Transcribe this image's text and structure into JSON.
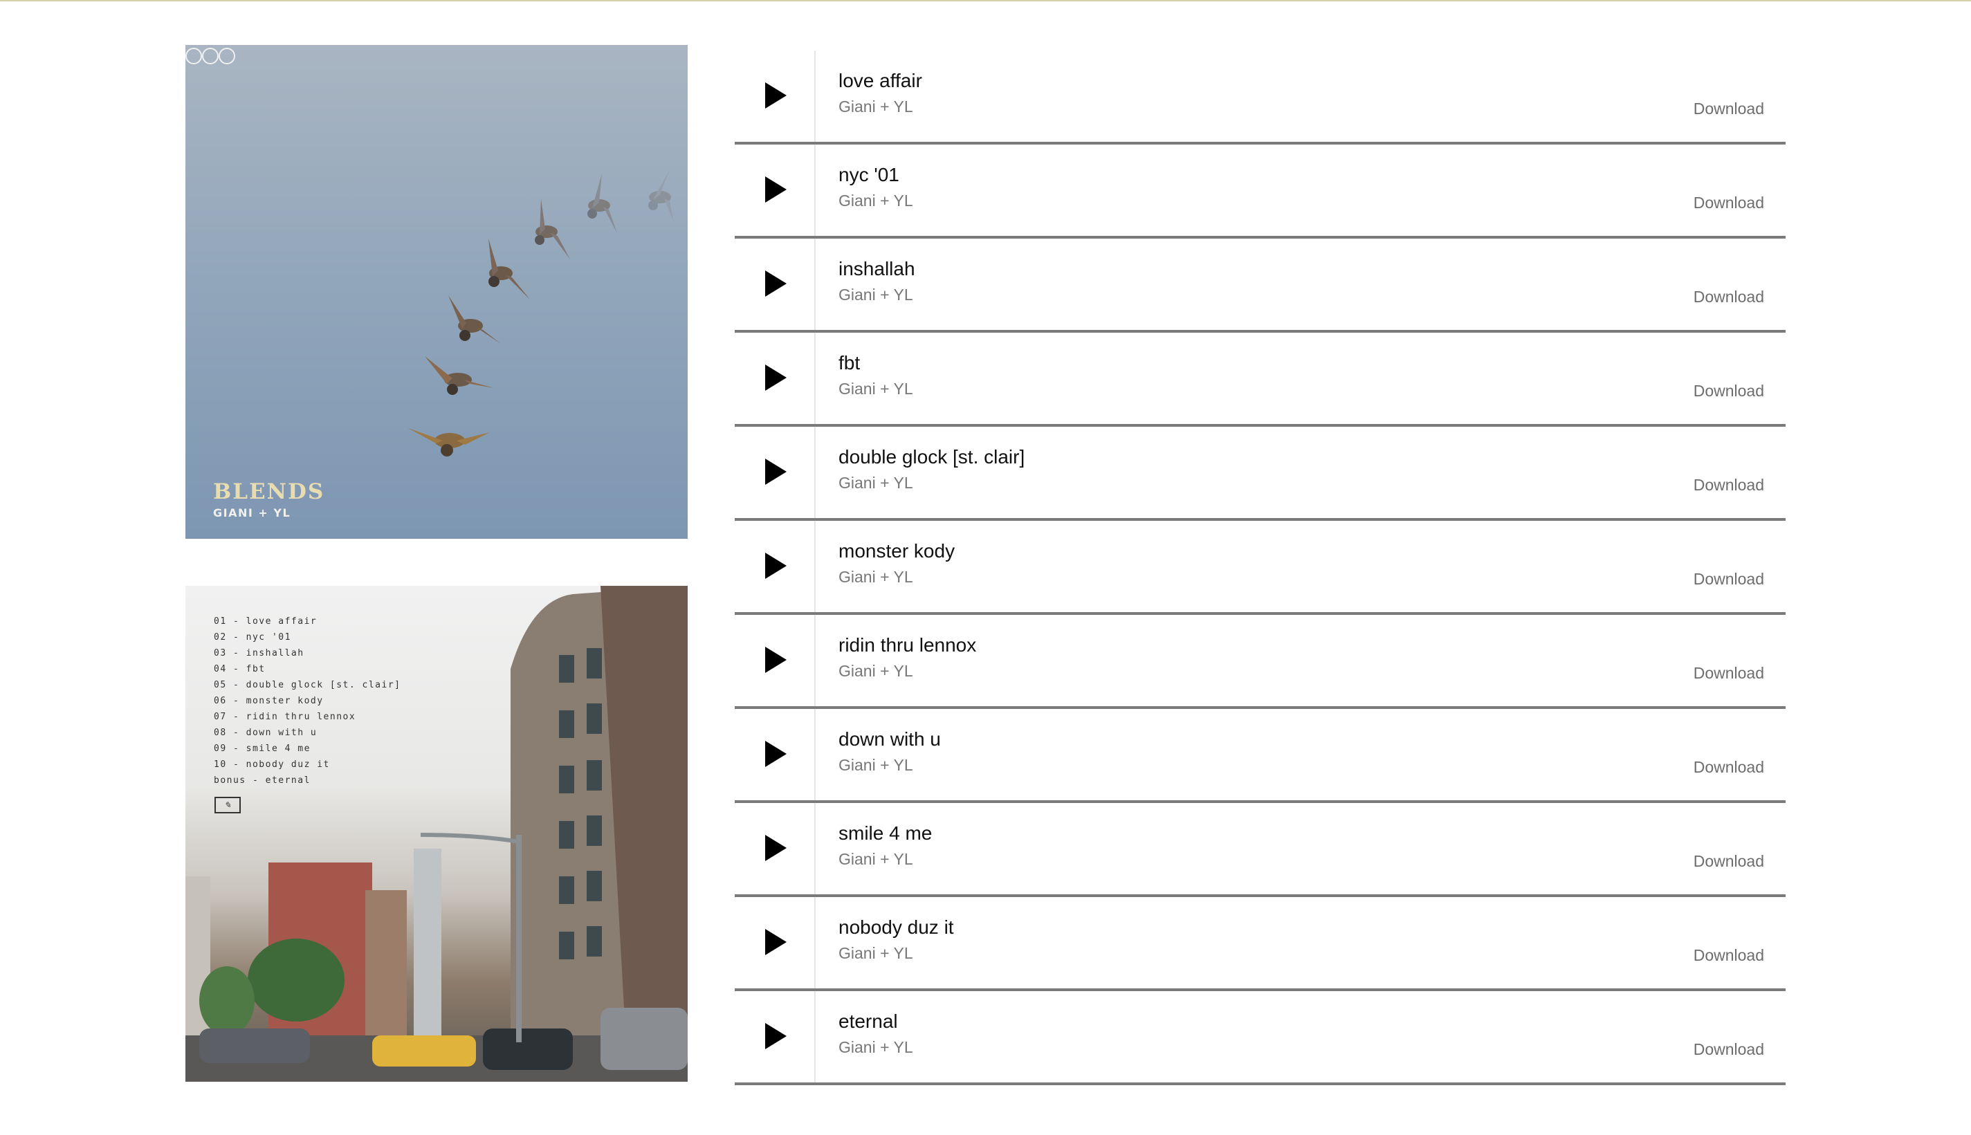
{
  "album": {
    "front_cover": {
      "logo_text": "BLENDS",
      "artist_text": "GIANI + YL",
      "badge_icons": [
        "circle-badge",
        "circle-badge",
        "circle-badge"
      ]
    },
    "back_cover": {
      "tracklist": [
        "01 - love affair",
        "02 - nyc '01",
        "03 - inshallah",
        "04 - fbt",
        "05 - double glock [st. clair]",
        "06 - monster kody",
        "07 - ridin thru lennox",
        "08 - down with u",
        "09 - smile 4 me",
        "10 - nobody duz it",
        "bonus - eternal"
      ]
    }
  },
  "tracks": [
    {
      "title": "love affair",
      "artist": "Giani + YL",
      "download_label": "Download"
    },
    {
      "title": "nyc '01",
      "artist": "Giani + YL",
      "download_label": "Download"
    },
    {
      "title": "inshallah",
      "artist": "Giani + YL",
      "download_label": "Download"
    },
    {
      "title": "fbt",
      "artist": "Giani + YL",
      "download_label": "Download"
    },
    {
      "title": "double glock [st. clair]",
      "artist": "Giani + YL",
      "download_label": "Download"
    },
    {
      "title": "monster kody",
      "artist": "Giani + YL",
      "download_label": "Download"
    },
    {
      "title": "ridin thru lennox",
      "artist": "Giani + YL",
      "download_label": "Download"
    },
    {
      "title": "down with u",
      "artist": "Giani + YL",
      "download_label": "Download"
    },
    {
      "title": "smile 4 me",
      "artist": "Giani + YL",
      "download_label": "Download"
    },
    {
      "title": "nobody duz it",
      "artist": "Giani + YL",
      "download_label": "Download"
    },
    {
      "title": "eternal",
      "artist": "Giani + YL",
      "download_label": "Download"
    }
  ],
  "icons": {
    "play": "play-icon"
  },
  "colors": {
    "top_rule": "#d9cfa8",
    "divider": "#7a7a7a",
    "sky": "#8fa4ba"
  }
}
